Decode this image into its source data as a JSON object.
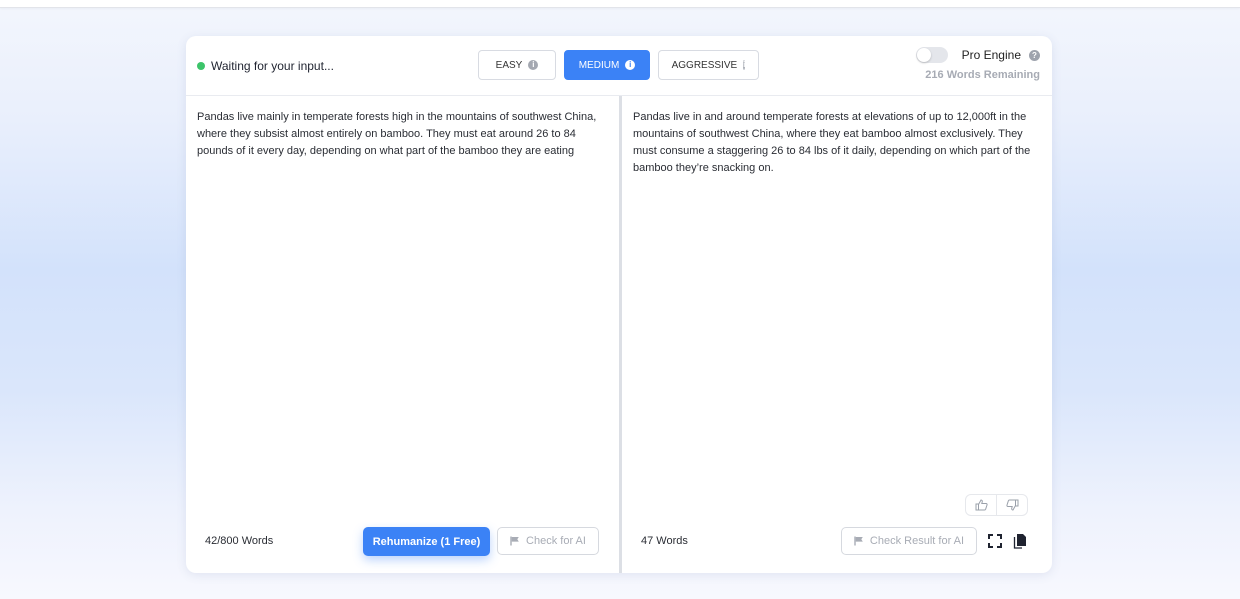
{
  "header": {
    "status_text": "Waiting for your input...",
    "status_color": "#3cc46a",
    "modes": [
      {
        "label": "EASY",
        "selected": false
      },
      {
        "label": "MEDIUM",
        "selected": true
      },
      {
        "label": "AGGRESSIVE",
        "selected": false
      }
    ],
    "pro_engine_label": "Pro Engine",
    "pro_engine_enabled": false,
    "words_remaining": "216 Words Remaining"
  },
  "input_pane": {
    "text": "Pandas live mainly in temperate forests high in the mountains of southwest China, where they subsist almost entirely on bamboo. They must eat around 26 to 84 pounds of it every day, depending on what part of the bamboo they are eating",
    "word_count": "42/800 Words",
    "rehumanize_label": "Rehumanize (1 Free)",
    "check_label": "Check for AI"
  },
  "output_pane": {
    "text": "Pandas live in and around temperate forests at elevations of up to 12,000ft in the mountains of southwest China, where they eat bamboo almost exclusively. They must consume a staggering 26 to 84 lbs of it daily, depending on which part of the bamboo they’re snacking on.",
    "word_count": "47 Words",
    "check_label": "Check Result for AI"
  },
  "colors": {
    "accent": "#3b82f6"
  }
}
